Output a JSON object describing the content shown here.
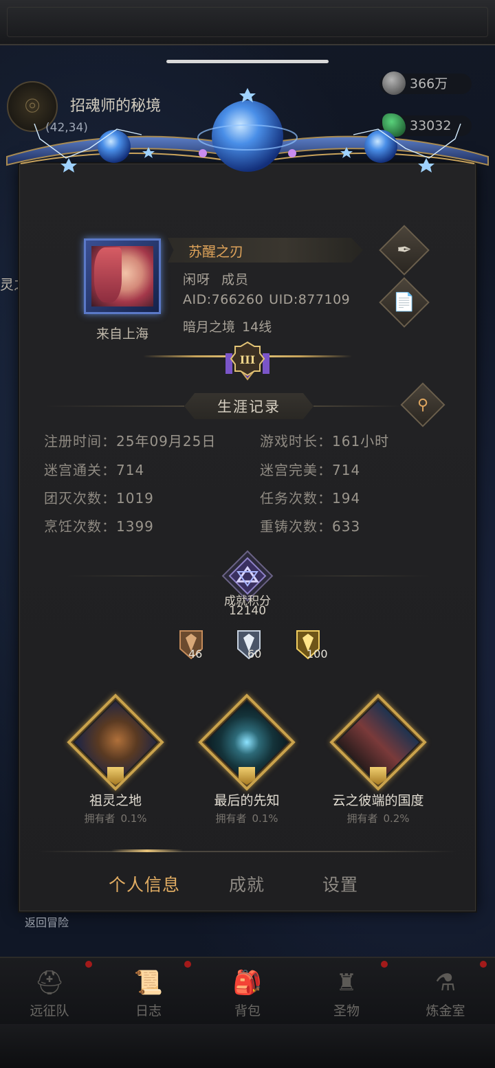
{
  "map": {
    "title": "招魂师的秘境",
    "coords": "(42,34)"
  },
  "resources": [
    {
      "name": "silver-ore",
      "value": "366万"
    },
    {
      "name": "green-gem",
      "value": "33032"
    }
  ],
  "background": {
    "left_text": "灵之",
    "back_label": "返回冒险"
  },
  "profile": {
    "name": "苏醒之刃",
    "guild": "闲呀",
    "role": "成员",
    "aid": "AID:766260",
    "uid": "UID:877109",
    "server": "暗月之境",
    "line": "14线",
    "origin": "来自上海",
    "rank": "III"
  },
  "career": {
    "title": "生涯记录",
    "stats": [
      {
        "label": "注册时间：",
        "value": "25年09月25日"
      },
      {
        "label": "游戏时长：",
        "value": "161小时"
      },
      {
        "label": "迷宫通关：",
        "value": "714"
      },
      {
        "label": "迷宫完美：",
        "value": "714"
      },
      {
        "label": "团灭次数：",
        "value": "1019"
      },
      {
        "label": "任务次数：",
        "value": "194"
      },
      {
        "label": "烹饪次数：",
        "value": "1399"
      },
      {
        "label": "重铸次数：",
        "value": "633"
      }
    ]
  },
  "achievement": {
    "title": "成就积分",
    "score": "12140",
    "medals": [
      {
        "tier": "bronze",
        "count": "46"
      },
      {
        "tier": "silver",
        "count": "60"
      },
      {
        "tier": "gold",
        "count": "100"
      }
    ],
    "cards": [
      {
        "name": "祖灵之地",
        "owner_label": "拥有者",
        "owner_pct": "0.1%"
      },
      {
        "name": "最后的先知",
        "owner_label": "拥有者",
        "owner_pct": "0.1%"
      },
      {
        "name": "云之彼端的国度",
        "owner_label": "拥有者",
        "owner_pct": "0.2%"
      }
    ]
  },
  "tabs": [
    {
      "label": "个人信息",
      "active": true
    },
    {
      "label": "成就",
      "active": false
    },
    {
      "label": "设置",
      "active": false
    }
  ],
  "nav": [
    {
      "label": "远征队",
      "icon": "viking-helmet-icon"
    },
    {
      "label": "日志",
      "icon": "scroll-icon"
    },
    {
      "label": "背包",
      "icon": "backpack-icon"
    },
    {
      "label": "圣物",
      "icon": "relic-icon"
    },
    {
      "label": "炼金室",
      "icon": "alchemy-icon"
    }
  ],
  "colors": {
    "accent_gold": "#e2ad63",
    "name_orange": "#e0a45a",
    "panel_bg": "#222224"
  }
}
